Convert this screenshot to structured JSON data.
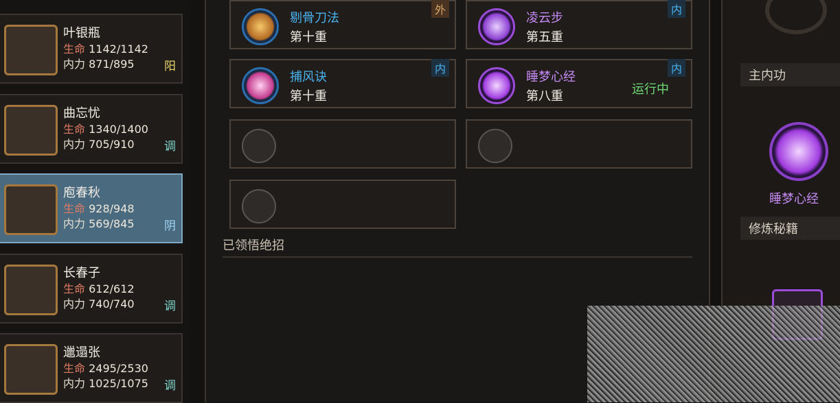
{
  "characters": [
    {
      "name": "叶银瓶",
      "hp_label": "生命",
      "hp": "1142/1142",
      "mp_label": "内力",
      "mp": "871/895",
      "tag": "阳",
      "tag_color": "#e6d36a"
    },
    {
      "name": "曲忘忧",
      "hp_label": "生命",
      "hp": "1340/1400",
      "mp_label": "内力",
      "mp": "705/910",
      "tag": "调",
      "tag_color": "#7ed4c9"
    },
    {
      "name": "庖春秋",
      "hp_label": "生命",
      "hp": "928/948",
      "mp_label": "内力",
      "mp": "569/845",
      "tag": "阴",
      "tag_color": "#9fd7f2",
      "active": true
    },
    {
      "name": "长春子",
      "hp_label": "生命",
      "hp": "612/612",
      "mp_label": "内力",
      "mp": "740/740",
      "tag": "调",
      "tag_color": "#7ed4c9"
    },
    {
      "name": "邋遢张",
      "hp_label": "生命",
      "hp": "2495/2530",
      "mp_label": "内力",
      "mp": "1025/1075",
      "tag": "调",
      "tag_color": "#7ed4c9"
    }
  ],
  "skills": [
    {
      "name": "剔骨刀法",
      "level": "第十重",
      "badge": "外",
      "name_color": "#4ab3f0",
      "badge_color": "#d6a86a"
    },
    {
      "name": "凌云步",
      "level": "第五重",
      "badge": "内",
      "name_color": "#c58af2",
      "badge_color": "#4ab3f0"
    },
    {
      "name": "捕风诀",
      "level": "第十重",
      "badge": "内",
      "name_color": "#4ab3f0",
      "badge_color": "#4ab3f0"
    },
    {
      "name": "睡梦心经",
      "level": "第八重",
      "badge": "内",
      "name_color": "#c58af2",
      "badge_color": "#4ab3f0",
      "status": "运行中"
    }
  ],
  "section_title": "已领悟绝招",
  "right": {
    "main_inner_label": "主内功",
    "main_inner_skill": "睡梦心经",
    "cultivation_label": "修炼秘籍"
  }
}
